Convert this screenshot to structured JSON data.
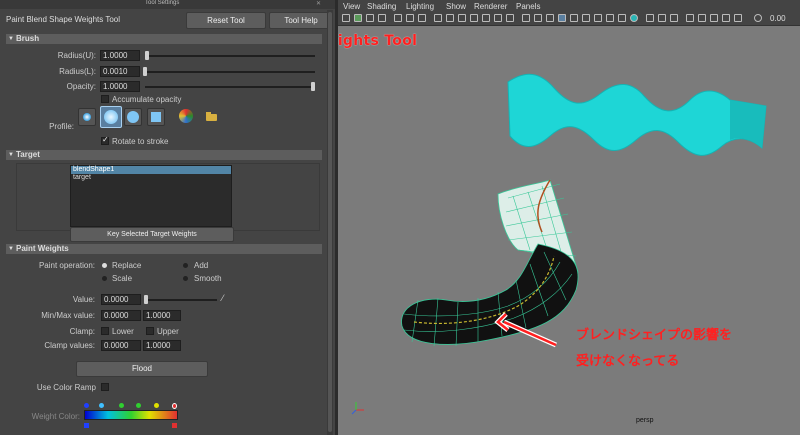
{
  "tool_settings": {
    "window_title": "Tool Settings",
    "tool_name": "Paint Blend Shape Weights Tool",
    "reset_label": "Reset Tool",
    "help_label": "Tool Help"
  },
  "brush": {
    "section": "Brush",
    "radius_u_label": "Radius(U):",
    "radius_u": "1.0000",
    "radius_l_label": "Radius(L):",
    "radius_l": "0.0010",
    "opacity_label": "Opacity:",
    "opacity": "1.0000",
    "accumulate_label": "Accumulate opacity",
    "profile_label": "Profile:",
    "rotate_label": "Rotate to stroke"
  },
  "target": {
    "section": "Target",
    "items": [
      "blendShape1",
      "target"
    ],
    "key_button": "Key Selected Target Weights"
  },
  "paint_weights": {
    "section": "Paint Weights",
    "operation_label": "Paint operation:",
    "ops": [
      "Replace",
      "Add",
      "Scale",
      "Smooth"
    ],
    "value_label": "Value:",
    "value": "0.0000",
    "minmax_label": "Min/Max value:",
    "min": "0.0000",
    "max": "1.0000",
    "clamp_label": "Clamp:",
    "lower_label": "Lower",
    "upper_label": "Upper",
    "clamp_values_label": "Clamp values:",
    "clamp_min": "0.0000",
    "clamp_max": "1.0000",
    "flood_label": "Flood",
    "color_ramp_label": "Use Color Ramp",
    "weight_color_label": "Weight Color:"
  },
  "viewport": {
    "menus": [
      "View",
      "Shading",
      "Lighting",
      "Show",
      "Renderer",
      "Panels"
    ],
    "toolbar_value": "0.00",
    "camera_label": "persp"
  },
  "annotations": {
    "title": "Paint Blend Shape Weights Tool",
    "note_line1": "ブレンドシェイプの影響を",
    "note_line2": "受けなくなってる"
  },
  "colors": {
    "accent_red": "#ff2020",
    "wave_cyan": "#1ed6d6",
    "selection_blue": "#5285a6"
  }
}
